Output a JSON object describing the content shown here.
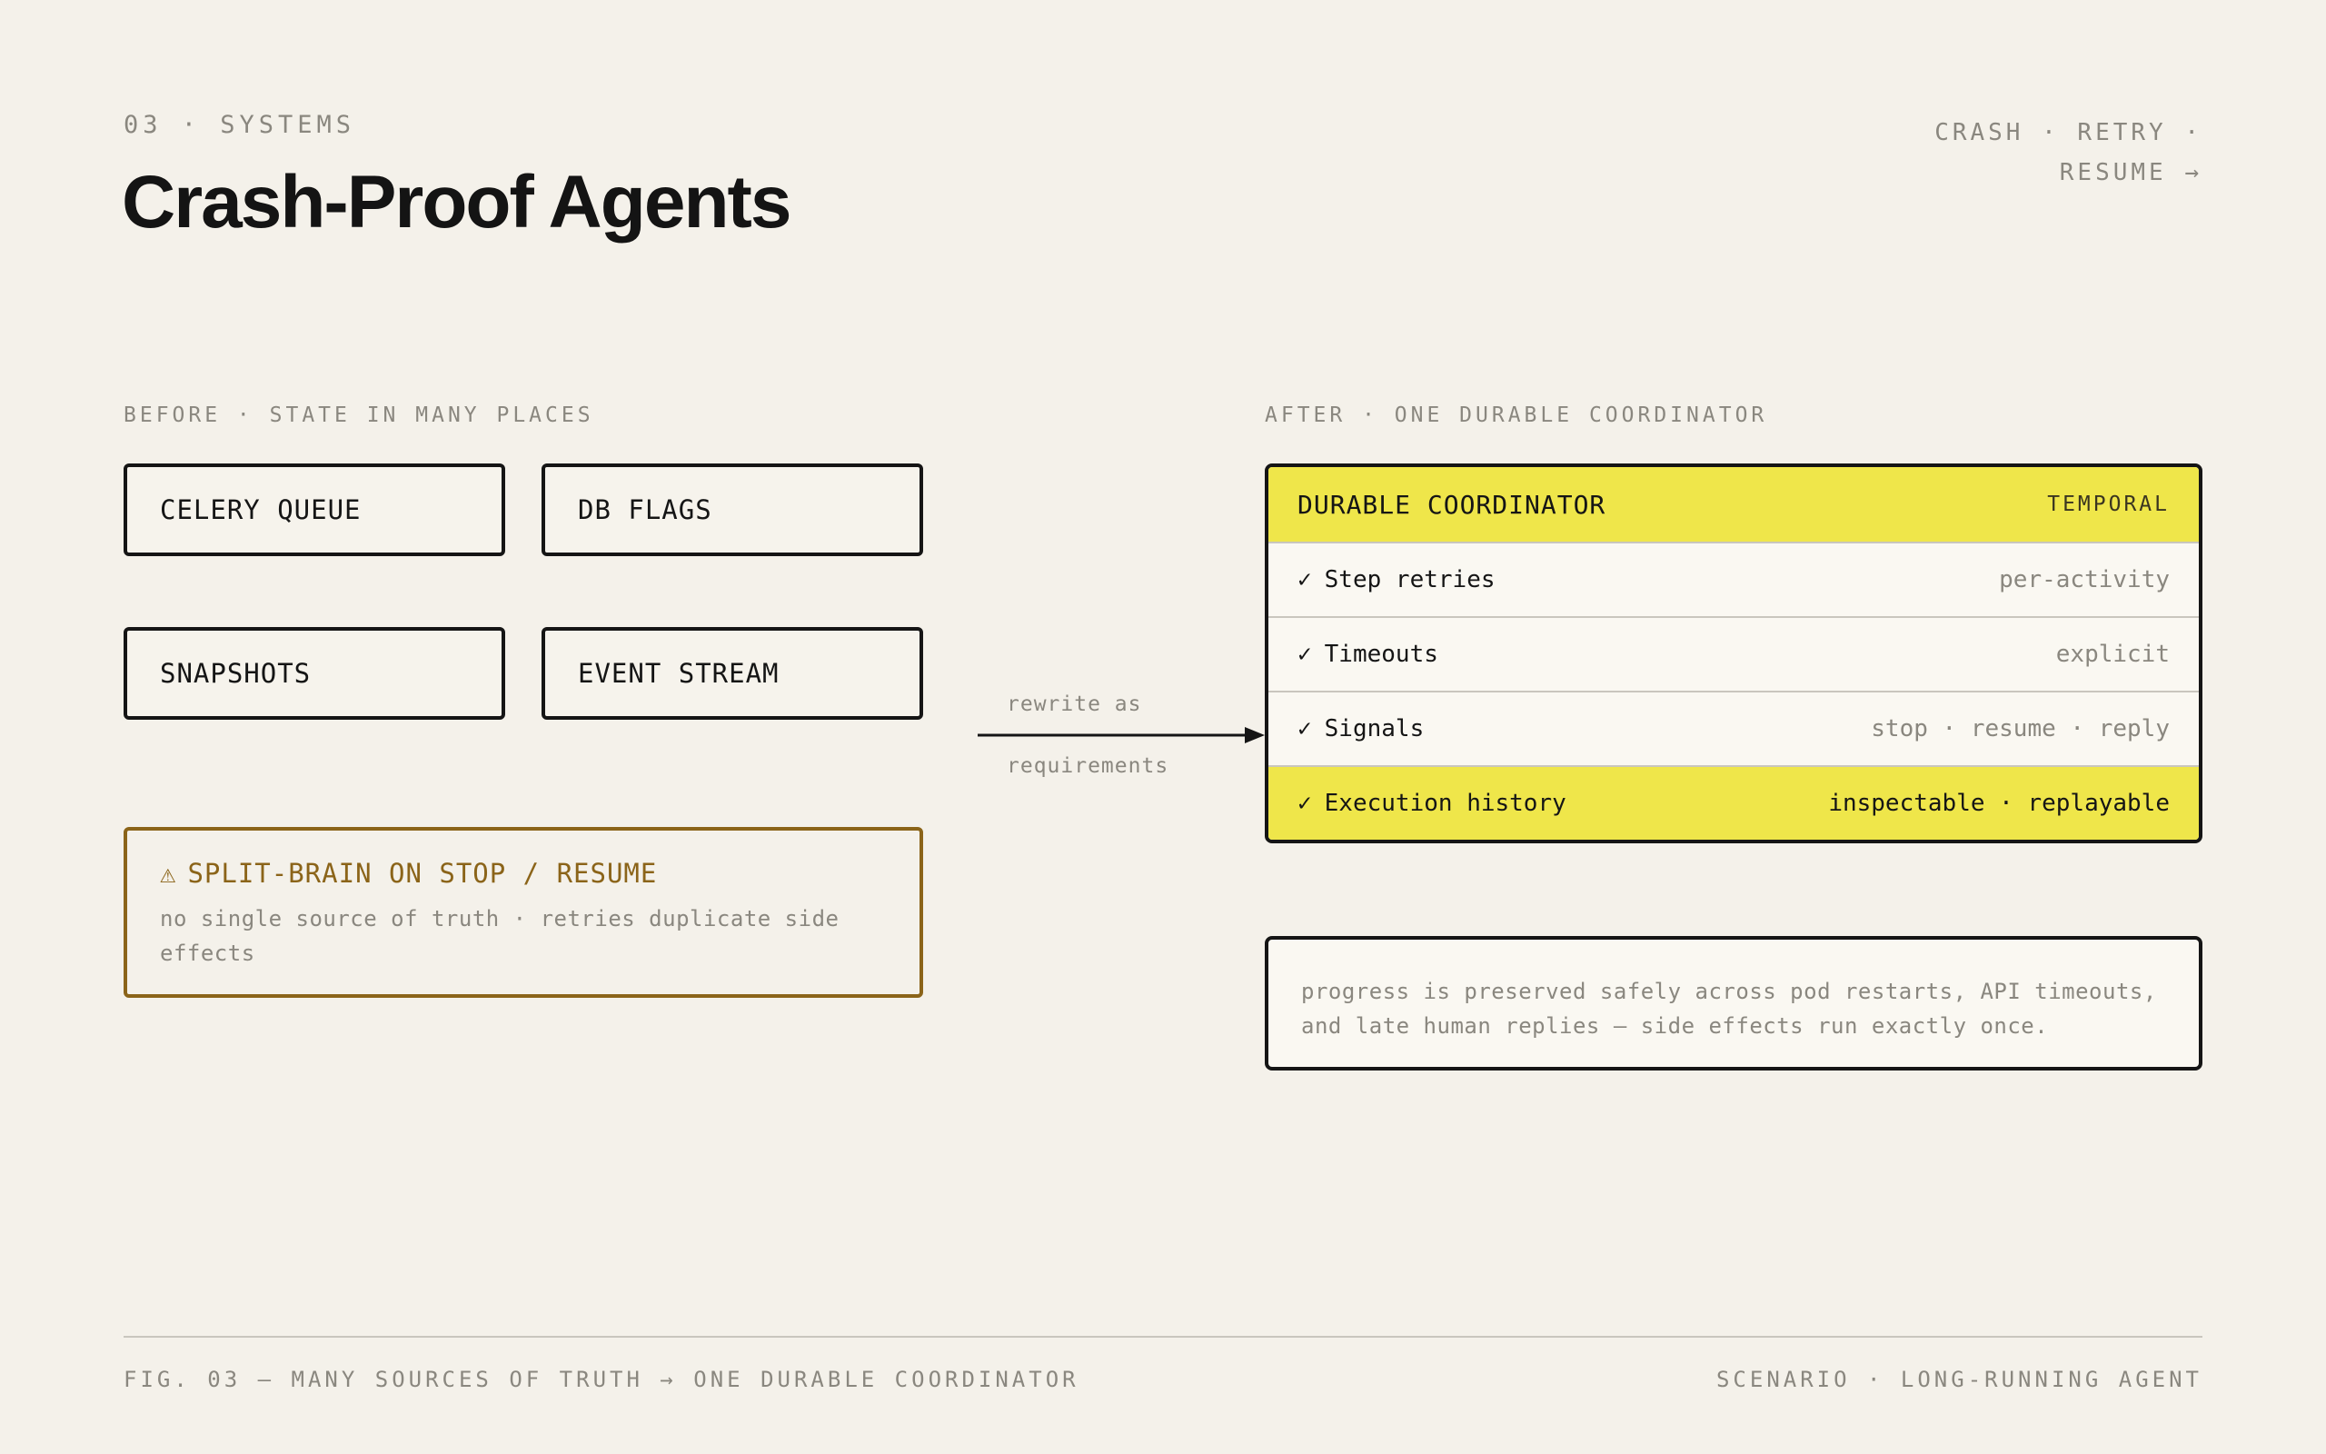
{
  "header": {
    "eyebrow": "03 · SYSTEMS",
    "title": "Crash-Proof Agents",
    "tagline": "CRASH · RETRY · RESUME →"
  },
  "before": {
    "label": "BEFORE · STATE IN MANY PLACES",
    "sources": [
      "CELERY QUEUE",
      "DB FLAGS",
      "SNAPSHOTS",
      "EVENT STREAM"
    ],
    "warning": {
      "icon": "warning-icon",
      "symbol": "⚠",
      "title": "SPLIT-BRAIN ON STOP / RESUME",
      "description": "no single source of truth · retries duplicate side effects"
    }
  },
  "arrow": {
    "label_top": "rewrite as",
    "label_bottom": "requirements"
  },
  "after": {
    "label": "AFTER · ONE DURABLE COORDINATOR",
    "coordinator": {
      "title": "DURABLE COORDINATOR",
      "tag": "TEMPORAL",
      "check_symbol": "✓",
      "rows": [
        {
          "label": "Step retries",
          "value": "per-activity",
          "highlight": false
        },
        {
          "label": "Timeouts",
          "value": "explicit",
          "highlight": false
        },
        {
          "label": "Signals",
          "value": "stop · resume · reply",
          "highlight": false
        },
        {
          "label": "Execution history",
          "value": "inspectable · replayable",
          "highlight": true
        }
      ]
    },
    "note": "progress is preserved safely across pod restarts, API timeouts, and late human replies — side effects run exactly once."
  },
  "footer": {
    "caption": "FIG. 03 — MANY SOURCES OF TRUTH → ONE DURABLE COORDINATOR",
    "scenario": "SCENARIO · LONG-RUNNING AGENT"
  },
  "colors": {
    "background": "#f4f1ea",
    "ink": "#151515",
    "muted": "#8a877f",
    "accent_yellow": "#efe64a",
    "warning": "#8b6419"
  }
}
